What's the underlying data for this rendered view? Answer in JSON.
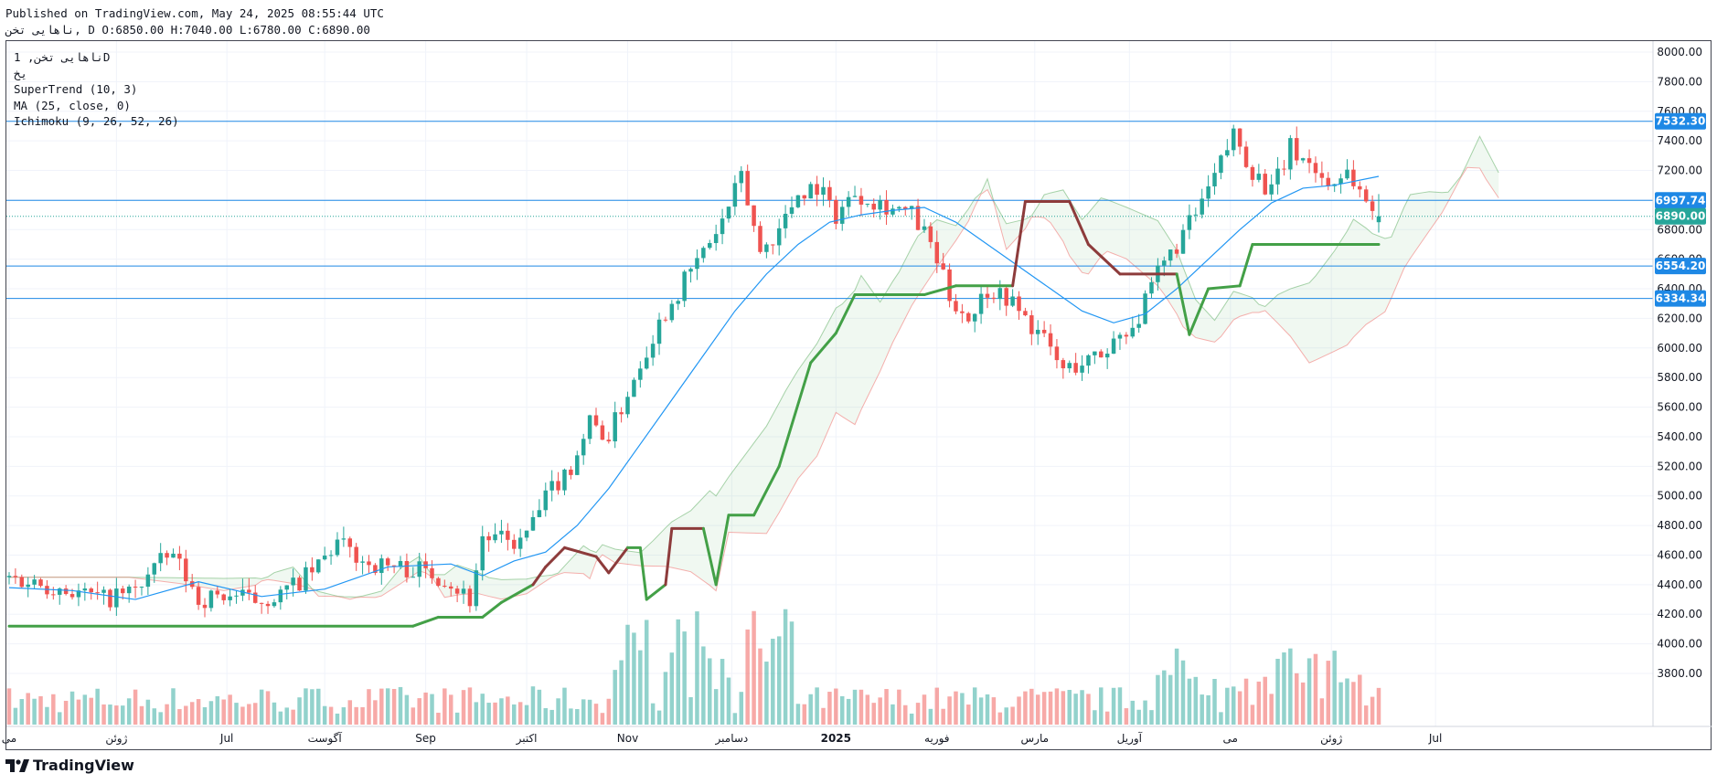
{
  "header": {
    "published": "Published on TradingView.com, May 24, 2025 08:55:44 UTC",
    "ohlc": "ناهایی تخن, D O:6850.00 H:7040.00 L:6780.00 C:6890.00"
  },
  "legend": {
    "symbol": "ناهایی تخن, 1D",
    "exchange": "یخ",
    "supertrend": "SuperTrend (10, 3)",
    "ma": "MA (25, close, 0)",
    "ichimoku": "Ichimoku (9, 26, 52, 26)"
  },
  "footer": {
    "brand": "TradingView",
    "logo_icon": "tradingview-logo-icon"
  },
  "colors": {
    "up": "#26a69a",
    "down": "#ef5350",
    "ma": "#2196f3",
    "supertrend_up": "#43a047",
    "supertrend_down": "#8d3b3b",
    "hline": "#1e88e5",
    "last_price": "#26a69a"
  },
  "chart_data": {
    "type": "candlestick",
    "y_ticks": [
      "3800.00",
      "4000.00",
      "4200.00",
      "4400.00",
      "4600.00",
      "4800.00",
      "5000.00",
      "5200.00",
      "5400.00",
      "5600.00",
      "5800.00",
      "6000.00",
      "6200.00",
      "6400.00",
      "6600.00",
      "6800.00",
      "7000.00",
      "7200.00",
      "7400.00",
      "7600.00",
      "7800.00",
      "8000.00"
    ],
    "x_labels": [
      "می",
      "ژوئن",
      "Jul",
      "آگوست",
      "Sep",
      "اکتبر",
      "Nov",
      "دسامبر",
      "2025",
      "فوریه",
      "مارس",
      "آوریل",
      "می",
      "ژوئن",
      "Jul"
    ],
    "ylim": [
      3640,
      8060
    ],
    "horizontal_lines": [
      {
        "value": 7532.3,
        "label": "7532.30"
      },
      {
        "value": 6997.74,
        "label": "6997.74"
      },
      {
        "value": 6554.2,
        "label": "6554.20"
      },
      {
        "value": 6334.34,
        "label": "6334.34"
      }
    ],
    "last_price": {
      "value": 6890.0,
      "label": "6890.00"
    },
    "last_bar": {
      "open": 6850.0,
      "high": 7040.0,
      "low": 6780.0,
      "close": 6890.0
    },
    "close_series": [
      {
        "t": 0,
        "v": 4450
      },
      {
        "t": 16,
        "v": 4380
      },
      {
        "t": 30,
        "v": 4300
      },
      {
        "t": 40,
        "v": 4360
      },
      {
        "t": 46,
        "v": 4520
      },
      {
        "t": 52,
        "v": 4600
      },
      {
        "t": 60,
        "v": 4300
      },
      {
        "t": 70,
        "v": 4330
      },
      {
        "t": 78,
        "v": 4290
      },
      {
        "t": 86,
        "v": 4330
      },
      {
        "t": 96,
        "v": 4480
      },
      {
        "t": 104,
        "v": 4680
      },
      {
        "t": 114,
        "v": 4540
      },
      {
        "t": 122,
        "v": 4520
      },
      {
        "t": 130,
        "v": 4500
      },
      {
        "t": 138,
        "v": 4450
      },
      {
        "t": 146,
        "v": 4300
      },
      {
        "t": 150,
        "v": 4720
      },
      {
        "t": 156,
        "v": 4700
      },
      {
        "t": 162,
        "v": 4680
      },
      {
        "t": 166,
        "v": 4820
      },
      {
        "t": 172,
        "v": 5050
      },
      {
        "t": 178,
        "v": 5200
      },
      {
        "t": 184,
        "v": 5500
      },
      {
        "t": 190,
        "v": 5400
      },
      {
        "t": 196,
        "v": 5700
      },
      {
        "t": 202,
        "v": 6000
      },
      {
        "t": 208,
        "v": 6250
      },
      {
        "t": 214,
        "v": 6450
      },
      {
        "t": 220,
        "v": 6650
      },
      {
        "t": 226,
        "v": 6850
      },
      {
        "t": 232,
        "v": 7150
      },
      {
        "t": 238,
        "v": 6650
      },
      {
        "t": 244,
        "v": 6800
      },
      {
        "t": 250,
        "v": 7050
      },
      {
        "t": 256,
        "v": 7100
      },
      {
        "t": 262,
        "v": 6900
      },
      {
        "t": 268,
        "v": 7050
      },
      {
        "t": 274,
        "v": 7000
      },
      {
        "t": 280,
        "v": 6950
      },
      {
        "t": 286,
        "v": 6900
      },
      {
        "t": 292,
        "v": 6700
      },
      {
        "t": 298,
        "v": 6350
      },
      {
        "t": 304,
        "v": 6200
      },
      {
        "t": 310,
        "v": 6400
      },
      {
        "t": 316,
        "v": 6350
      },
      {
        "t": 322,
        "v": 6200
      },
      {
        "t": 328,
        "v": 6050
      },
      {
        "t": 334,
        "v": 5850
      },
      {
        "t": 340,
        "v": 5900
      },
      {
        "t": 346,
        "v": 5950
      },
      {
        "t": 352,
        "v": 6100
      },
      {
        "t": 358,
        "v": 6200
      },
      {
        "t": 364,
        "v": 6500
      },
      {
        "t": 370,
        "v": 6700
      },
      {
        "t": 376,
        "v": 6900
      },
      {
        "t": 382,
        "v": 7150
      },
      {
        "t": 388,
        "v": 7450
      },
      {
        "t": 394,
        "v": 7200
      },
      {
        "t": 400,
        "v": 7050
      },
      {
        "t": 406,
        "v": 7350
      },
      {
        "t": 412,
        "v": 7250
      },
      {
        "t": 418,
        "v": 7100
      },
      {
        "t": 424,
        "v": 7200
      },
      {
        "t": 430,
        "v": 6990
      },
      {
        "t": 434,
        "v": 6890
      }
    ],
    "ma_series": [
      {
        "t": 0,
        "v": 4380
      },
      {
        "t": 20,
        "v": 4360
      },
      {
        "t": 40,
        "v": 4300
      },
      {
        "t": 60,
        "v": 4420
      },
      {
        "t": 80,
        "v": 4320
      },
      {
        "t": 100,
        "v": 4370
      },
      {
        "t": 120,
        "v": 4520
      },
      {
        "t": 140,
        "v": 4540
      },
      {
        "t": 150,
        "v": 4460
      },
      {
        "t": 160,
        "v": 4560
      },
      {
        "t": 170,
        "v": 4620
      },
      {
        "t": 180,
        "v": 4800
      },
      {
        "t": 190,
        "v": 5050
      },
      {
        "t": 200,
        "v": 5350
      },
      {
        "t": 210,
        "v": 5650
      },
      {
        "t": 220,
        "v": 5950
      },
      {
        "t": 230,
        "v": 6250
      },
      {
        "t": 240,
        "v": 6500
      },
      {
        "t": 250,
        "v": 6700
      },
      {
        "t": 260,
        "v": 6850
      },
      {
        "t": 270,
        "v": 6900
      },
      {
        "t": 280,
        "v": 6930
      },
      {
        "t": 290,
        "v": 6950
      },
      {
        "t": 300,
        "v": 6850
      },
      {
        "t": 310,
        "v": 6700
      },
      {
        "t": 320,
        "v": 6550
      },
      {
        "t": 330,
        "v": 6400
      },
      {
        "t": 340,
        "v": 6250
      },
      {
        "t": 350,
        "v": 6170
      },
      {
        "t": 360,
        "v": 6230
      },
      {
        "t": 370,
        "v": 6400
      },
      {
        "t": 380,
        "v": 6600
      },
      {
        "t": 390,
        "v": 6800
      },
      {
        "t": 400,
        "v": 6980
      },
      {
        "t": 410,
        "v": 7080
      },
      {
        "t": 420,
        "v": 7100
      },
      {
        "t": 434,
        "v": 7160
      }
    ],
    "supertrend_series": [
      {
        "t": 0,
        "v": 4120,
        "d": "up"
      },
      {
        "t": 128,
        "v": 4120,
        "d": "up"
      },
      {
        "t": 136,
        "v": 4180,
        "d": "up"
      },
      {
        "t": 150,
        "v": 4180,
        "d": "up"
      },
      {
        "t": 156,
        "v": 4280,
        "d": "up"
      },
      {
        "t": 166,
        "v": 4400,
        "d": "up"
      },
      {
        "t": 170,
        "v": 4520,
        "d": "down"
      },
      {
        "t": 176,
        "v": 4650,
        "d": "down"
      },
      {
        "t": 186,
        "v": 4590,
        "d": "down"
      },
      {
        "t": 190,
        "v": 4480,
        "d": "down"
      },
      {
        "t": 196,
        "v": 4650,
        "d": "down"
      },
      {
        "t": 200,
        "v": 4650,
        "d": "up"
      },
      {
        "t": 202,
        "v": 4300,
        "d": "up"
      },
      {
        "t": 208,
        "v": 4400,
        "d": "up"
      },
      {
        "t": 210,
        "v": 4780,
        "d": "down"
      },
      {
        "t": 220,
        "v": 4780,
        "d": "down"
      },
      {
        "t": 224,
        "v": 4400,
        "d": "up"
      },
      {
        "t": 228,
        "v": 4870,
        "d": "up"
      },
      {
        "t": 236,
        "v": 4870,
        "d": "up"
      },
      {
        "t": 244,
        "v": 5200,
        "d": "up"
      },
      {
        "t": 254,
        "v": 5900,
        "d": "up"
      },
      {
        "t": 262,
        "v": 6100,
        "d": "up"
      },
      {
        "t": 268,
        "v": 6360,
        "d": "up"
      },
      {
        "t": 290,
        "v": 6360,
        "d": "up"
      },
      {
        "t": 300,
        "v": 6420,
        "d": "up"
      },
      {
        "t": 318,
        "v": 6420,
        "d": "up"
      },
      {
        "t": 322,
        "v": 6990,
        "d": "down"
      },
      {
        "t": 336,
        "v": 6990,
        "d": "down"
      },
      {
        "t": 342,
        "v": 6700,
        "d": "down"
      },
      {
        "t": 352,
        "v": 6500,
        "d": "down"
      },
      {
        "t": 370,
        "v": 6500,
        "d": "down"
      },
      {
        "t": 374,
        "v": 6090,
        "d": "up"
      },
      {
        "t": 380,
        "v": 6400,
        "d": "up"
      },
      {
        "t": 390,
        "v": 6420,
        "d": "up"
      },
      {
        "t": 394,
        "v": 6700,
        "d": "up"
      },
      {
        "t": 434,
        "v": 6700,
        "d": "up"
      }
    ]
  }
}
